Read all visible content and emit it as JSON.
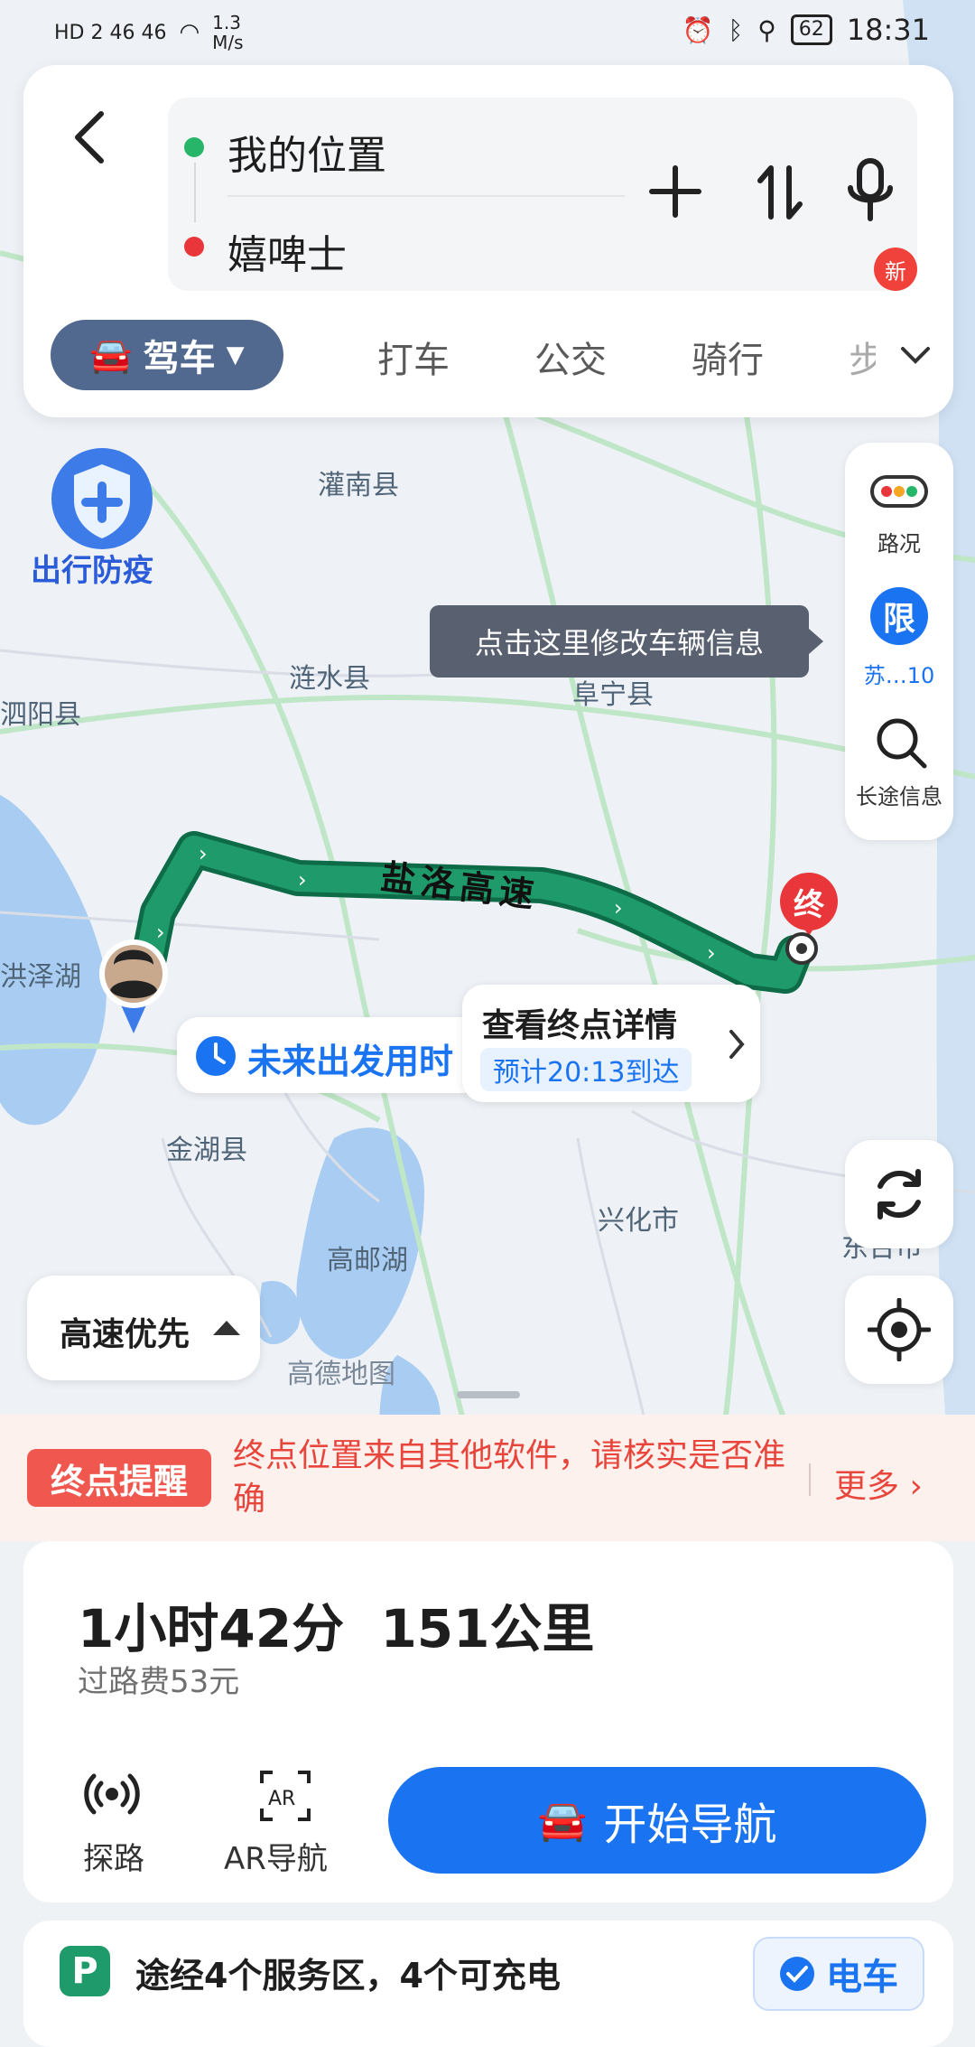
{
  "status_bar": {
    "left": "HD 2  46  46",
    "speed": "1.3 M/s",
    "battery": "62",
    "time": "18:31"
  },
  "search": {
    "origin": "我的位置",
    "destination": "嬉啤士"
  },
  "modes": {
    "active": "驾车",
    "items": [
      "打车",
      "公交",
      "骑行",
      "步"
    ],
    "new_badge": "新"
  },
  "side_panel": {
    "traffic": "路况",
    "restrict_badge": "限",
    "restrict_label": "苏…10",
    "longtrip": "长途信息"
  },
  "map": {
    "tooltip": "点击这里修改车辆信息",
    "epidemic_label": "出行防疫",
    "road_name": "盐洛高速",
    "end_marker": "终",
    "depart_label": "未来出发用时",
    "dest_title": "查看终点详情",
    "dest_eta": "预计20:13到达",
    "places": [
      "灌南县",
      "涟水县",
      "阜宁县",
      "泗阳县",
      "洪泽湖",
      "金湖县",
      "高邮湖",
      "兴化市",
      "东台市"
    ],
    "watermark": "高德地图",
    "route_pref": "高速优先"
  },
  "notice": {
    "tag": "终点提醒",
    "text": "终点位置来自其他软件，请核实是否准确",
    "more": "更多"
  },
  "route": {
    "duration_distance": "1小时42分  151公里",
    "toll": "过路费53元",
    "explore": "探路",
    "ar_nav": "AR导航",
    "start": "开始导航"
  },
  "service": {
    "text": "途经4个服务区，4个可充电",
    "ev": "电车"
  },
  "colors": {
    "route": "#168a5e",
    "accent": "#1a73f0",
    "alert": "#f0423a"
  }
}
